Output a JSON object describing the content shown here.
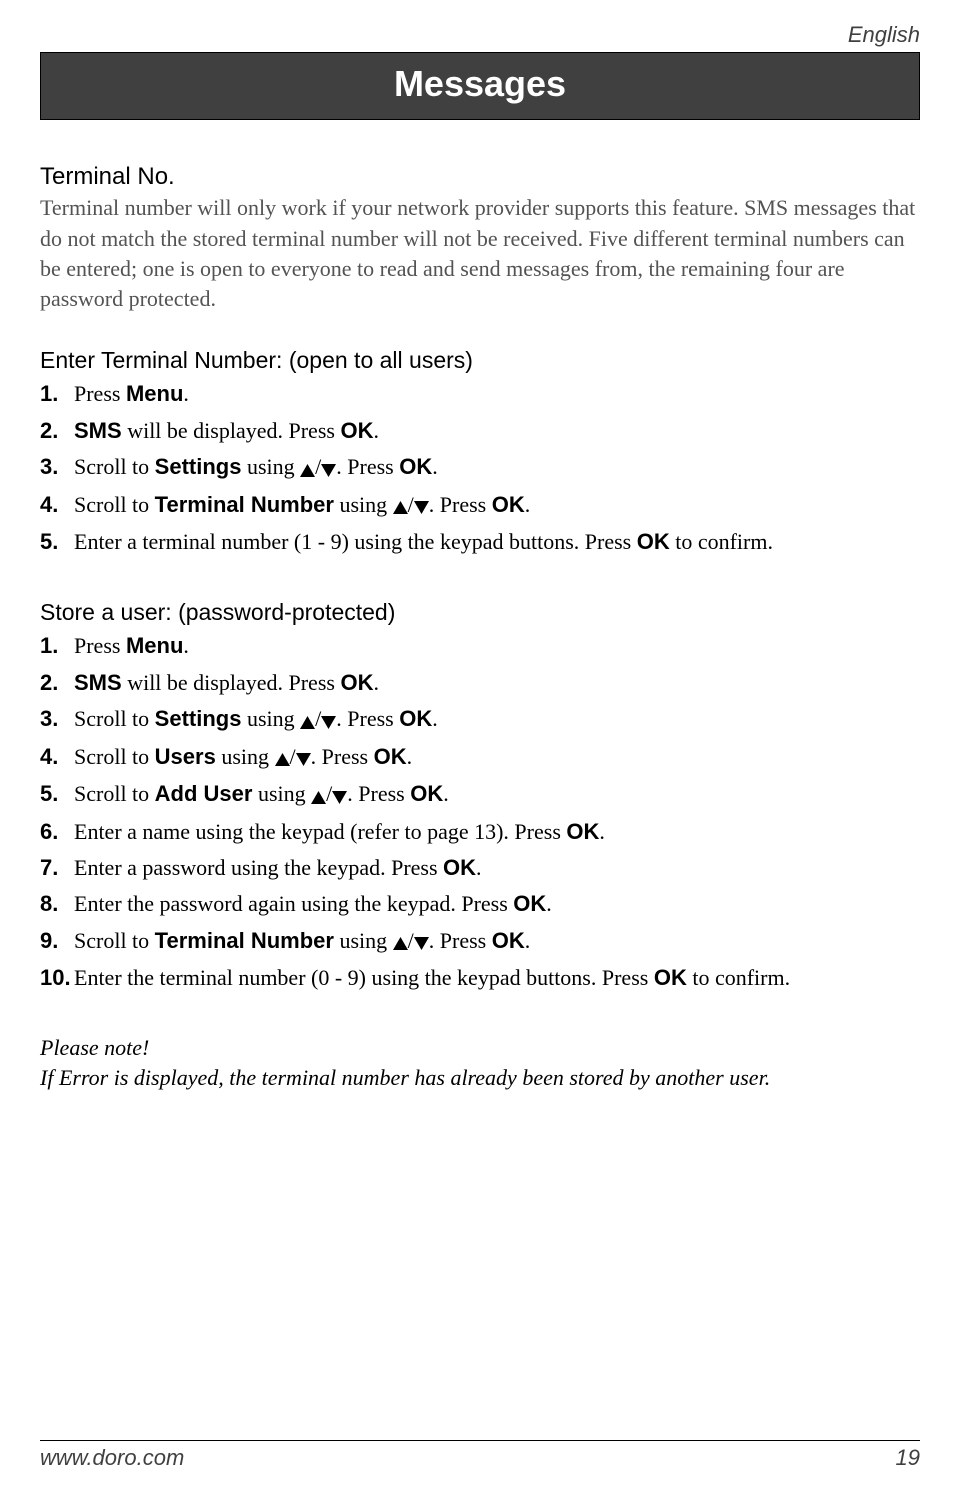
{
  "header": {
    "language": "English",
    "title": "Messages"
  },
  "section_title": "Terminal No.",
  "intro": "Terminal number will only work if your network provider supports this feature. SMS messages that do not match the stored terminal number will not be received. Five different terminal numbers can be entered; one is open to everyone to read and send messages from, the remaining four are password protected.",
  "listA": {
    "heading": "Enter Terminal Number: (open to all users)",
    "steps": [
      {
        "n": "1.",
        "pre": "Press ",
        "b1": "Menu",
        "post1": "."
      },
      {
        "n": "2.",
        "b0": "SMS",
        "mid": " will be displayed. Press ",
        "b1": "OK",
        "post1": "."
      },
      {
        "n": "3.",
        "pre": "Scroll to ",
        "b0": "Settings",
        "mid": " using ",
        "arrows": true,
        "post0": ". Press ",
        "b1": "OK",
        "post1": "."
      },
      {
        "n": "4.",
        "pre": "Scroll to ",
        "b0": "Terminal Number",
        "mid": " using ",
        "arrows": true,
        "post0": ". Press ",
        "b1": "OK",
        "post1": "."
      },
      {
        "n": "5.",
        "pre": "Enter a terminal number (1 - 9) using the keypad buttons. Press ",
        "b1": "OK",
        "post1": " to confirm."
      }
    ]
  },
  "listB": {
    "heading": "Store a user: (password-protected)",
    "steps": [
      {
        "n": "1.",
        "pre": "Press ",
        "b1": "Menu",
        "post1": "."
      },
      {
        "n": "2.",
        "b0": "SMS",
        "mid": " will be displayed. Press ",
        "b1": "OK",
        "post1": "."
      },
      {
        "n": "3.",
        "pre": "Scroll to ",
        "b0": "Settings",
        "mid": " using ",
        "arrows": true,
        "post0": ". Press ",
        "b1": "OK",
        "post1": "."
      },
      {
        "n": "4.",
        "pre": "Scroll to ",
        "b0": "Users",
        "mid": " using ",
        "arrows": true,
        "post0": ". Press ",
        "b1": "OK",
        "post1": "."
      },
      {
        "n": "5.",
        "pre": "Scroll to ",
        "b0": "Add User",
        "mid": " using ",
        "arrows": true,
        "post0": ". Press ",
        "b1": "OK",
        "post1": "."
      },
      {
        "n": "6.",
        "pre": "Enter a name using the keypad (refer to page 13). Press ",
        "b1": "OK",
        "post1": "."
      },
      {
        "n": "7.",
        "pre": "Enter a password using the keypad. Press ",
        "b1": "OK",
        "post1": "."
      },
      {
        "n": "8.",
        "pre": "Enter the password again using the keypad. Press ",
        "b1": "OK",
        "post1": "."
      },
      {
        "n": "9.",
        "pre": "Scroll to ",
        "b0": "Terminal Number",
        "mid": " using ",
        "arrows": true,
        "post0": ". Press ",
        "b1": "OK",
        "post1": "."
      },
      {
        "n": "10.",
        "pre": "Enter the terminal number (0 - 9) using the keypad buttons. Press ",
        "b1": "OK",
        "post1": " to confirm."
      }
    ]
  },
  "note": {
    "head": "Please note!",
    "body": "If Error is displayed, the terminal number has already been stored by another user."
  },
  "footer": {
    "url": "www.doro.com",
    "page": "19"
  }
}
